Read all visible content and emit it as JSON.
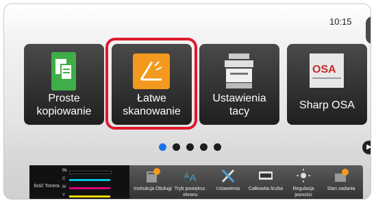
{
  "status": {
    "time": "10:15"
  },
  "tiles": [
    {
      "label_1": "Proste",
      "label_2": "kopiowanie",
      "icon": "copy-icon"
    },
    {
      "label_1": "Łatwe",
      "label_2": "skanowanie",
      "icon": "scan-icon"
    },
    {
      "label_1": "Ustawienia",
      "label_2": "tacy",
      "icon": "printer-icon"
    },
    {
      "label_1": "Sharp OSA",
      "label_2": "",
      "icon": "osa-icon",
      "logo_text": "OSA"
    }
  ],
  "pager": {
    "pages": 5,
    "current": 1
  },
  "toner": {
    "title": "Ilość Tonera",
    "labels": [
      "Bk",
      "C",
      "M",
      "Y"
    ],
    "colors": [
      "#000000",
      "#00c4e0",
      "#e0007a",
      "#f5d800"
    ]
  },
  "bottom_bar": [
    {
      "label": "Instrukcja Obsługi",
      "icon": "manual-icon"
    },
    {
      "label": "Tryb powiększ. ekranu",
      "icon": "zoom-text-icon"
    },
    {
      "label": "Ustawienia",
      "icon": "tools-icon"
    },
    {
      "label": "Całkowita liczba",
      "icon": "counter-icon"
    },
    {
      "label": "Regulacja jasności",
      "icon": "brightness-icon"
    },
    {
      "label": "Stan zadania",
      "icon": "job-status-icon"
    }
  ],
  "colors": {
    "highlight": "#e0182d",
    "copy_icon": "#3fae49",
    "scan_icon": "#f39a1e"
  }
}
